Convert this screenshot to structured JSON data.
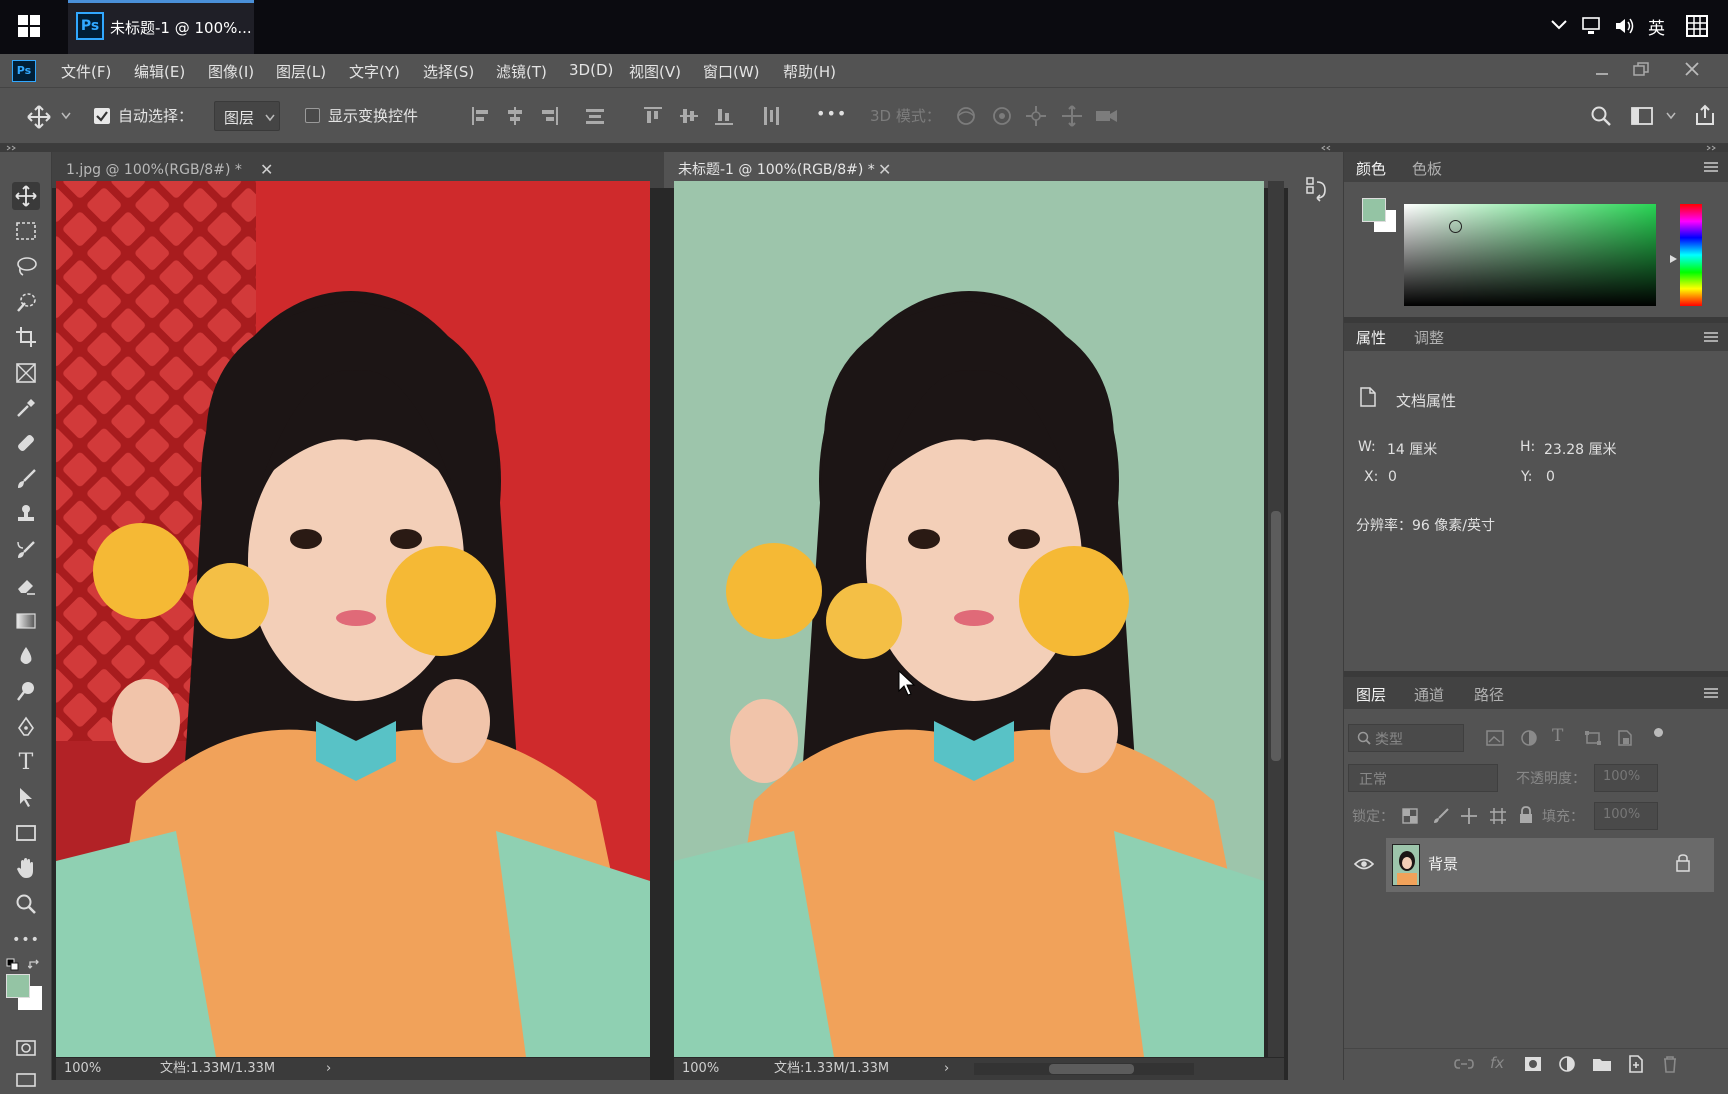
{
  "taskbar": {
    "app_icon_label": "Ps",
    "window_title": "未标题-1 @ 100%...",
    "tray_ime": "英"
  },
  "app": {
    "logo": "Ps"
  },
  "menu": [
    "文件(F)",
    "编辑(E)",
    "图像(I)",
    "图层(L)",
    "文字(Y)",
    "选择(S)",
    "滤镜(T)",
    "3D(D)",
    "视图(V)",
    "窗口(W)",
    "帮助(H)"
  ],
  "options": {
    "auto_select_label": "自动选择：",
    "auto_select_checked": true,
    "auto_select_target": "图层",
    "show_transform_label": "显示变换控件",
    "show_transform_checked": false,
    "more": "•••",
    "mode3d_label": "3D 模式："
  },
  "documents": [
    {
      "tab_label": "1.jpg @ 100%(RGB/8#) *",
      "active": false,
      "zoom": "100%",
      "doc_info": "文档:1.33M/1.33M",
      "background": "red"
    },
    {
      "tab_label": "未标题-1 @ 100%(RGB/8#) *",
      "active": true,
      "zoom": "100%",
      "doc_info": "文档:1.33M/1.33M",
      "background": "#9dc5ab"
    }
  ],
  "color_panel": {
    "tabs": [
      "颜色",
      "色板"
    ],
    "foreground": "#94c4a4",
    "background": "#ffffff"
  },
  "properties_panel": {
    "tabs": [
      "属性",
      "调整"
    ],
    "title": "文档属性",
    "w_label": "W:",
    "w_value": "14 厘米",
    "h_label": "H:",
    "h_value": "23.28 厘米",
    "x_label": "X:",
    "x_value": "0",
    "y_label": "Y:",
    "y_value": "0",
    "resolution": "分辨率：96 像素/英寸"
  },
  "layers_panel": {
    "tabs": [
      "图层",
      "通道",
      "路径"
    ],
    "filter_placeholder": "类型",
    "blend_mode": "正常",
    "opacity_label": "不透明度：",
    "opacity_value": "100%",
    "lock_label": "锁定：",
    "fill_label": "填充：",
    "fill_value": "100%",
    "layers": [
      {
        "name": "背景",
        "visible": true,
        "locked": true
      }
    ]
  }
}
